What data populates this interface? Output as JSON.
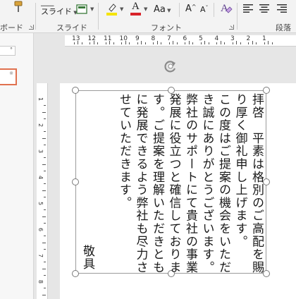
{
  "ribbon": {
    "slide_label": "スライド",
    "font_size_grow": "A",
    "font_size_shrink": "A",
    "case_label": "Aa",
    "groups": {
      "clipboard": "ボード",
      "slides": "スライド",
      "font": "フォント",
      "paragraph": "段落"
    },
    "colors": {
      "highlight": "#f5e400",
      "font_color": "#d8232a"
    }
  },
  "ruler": {
    "top_numbers": [
      "13",
      "12",
      "11",
      "10",
      "9",
      "8",
      "7",
      "6",
      "5",
      "4",
      "3",
      "2",
      "1"
    ],
    "left_numbers": [
      "1",
      "2",
      "3",
      "4",
      "5",
      "6",
      "7",
      "8"
    ]
  },
  "slide": {
    "lines": [
      "拝啓　平素は格別のご高配を賜",
      "り厚く御礼申し上げます。",
      "この度はご提案の機会をいただ",
      "き誠にありがとうございます。",
      "弊社のサポートにて貴社の事業",
      "発展に役立つと確信しておりま",
      "す。ご提案を理解いただきとも",
      "に発展できるよう弊社も尽力さ",
      "せていただきます。"
    ],
    "signoff": "敬具"
  },
  "icons": {
    "rotate": "rotate-handle-icon"
  }
}
